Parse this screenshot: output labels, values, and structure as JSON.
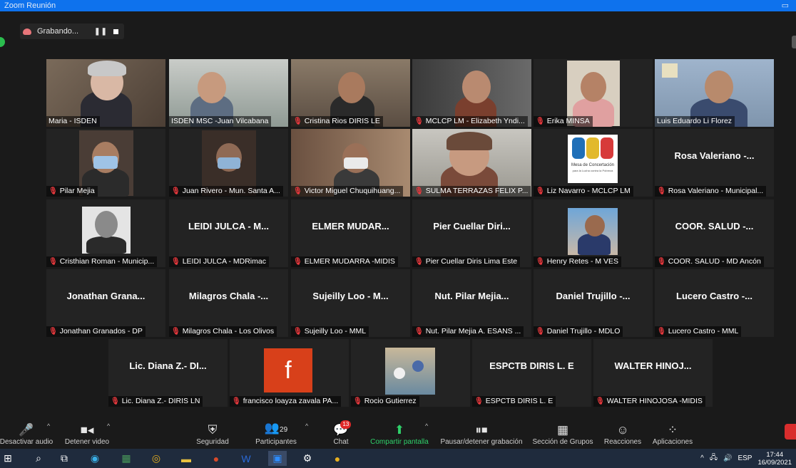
{
  "window": {
    "title": "Zoom Reunión"
  },
  "recording": {
    "label": "Grabando...",
    "pause_symbol": "❚❚"
  },
  "tiles": [
    {
      "name": "Maria - ISDEN",
      "muted": false,
      "video": true,
      "active": true
    },
    {
      "name": "ISDEN MSC -Juan Vilcabana",
      "muted": false,
      "video": true
    },
    {
      "name": "Cristina Rios DIRIS LE",
      "muted": true,
      "video": true
    },
    {
      "name": "MCLCP LM - Elizabeth Yndi...",
      "muted": true,
      "video": true
    },
    {
      "name": "Erika MINSA",
      "muted": true,
      "video": true
    },
    {
      "name": "Luis Eduardo Li Florez",
      "muted": false,
      "video": true
    },
    {
      "name": "Pilar Mejia",
      "muted": true,
      "video": true
    },
    {
      "name": "Juan Rivero - Mun. Santa A...",
      "muted": true,
      "video": true
    },
    {
      "name": "Victor Miguel Chuquihuang...",
      "muted": true,
      "video": true
    },
    {
      "name": "SULMA TERRAZAS FELIX P...",
      "muted": true,
      "video": true
    },
    {
      "name": "Liz Navarro - MCLCP LM",
      "muted": true,
      "video": true,
      "logo_caption": "Mesa de Concertación",
      "logo_subcaption": "para la Lucha contra la Pobreza"
    },
    {
      "name": "Rosa Valeriano - Municipal...",
      "muted": true,
      "video": false,
      "display": "Rosa Valeriano -..."
    },
    {
      "name": "Cristhian Roman - Municip...",
      "muted": true,
      "video": true
    },
    {
      "name": "LEIDI JULCA - MDRimac",
      "muted": true,
      "video": false,
      "display": "LEIDI JULCA - M..."
    },
    {
      "name": "ELMER MUDARRA -MIDIS",
      "muted": true,
      "video": false,
      "display": "ELMER MUDAR..."
    },
    {
      "name": "Pier Cuellar Diris Lima Este",
      "muted": true,
      "video": false,
      "display": "Pier Cuellar Diri..."
    },
    {
      "name": "Henry Retes - M VES",
      "muted": true,
      "video": true
    },
    {
      "name": "COOR. SALUD - MD Ancón",
      "muted": true,
      "video": false,
      "display": "COOR. SALUD -..."
    },
    {
      "name": "Jonathan Granados - DP",
      "muted": true,
      "video": false,
      "display": "Jonathan Grana..."
    },
    {
      "name": "Milagros Chala - Los Olivos",
      "muted": true,
      "video": false,
      "display": "Milagros Chala -..."
    },
    {
      "name": "Sujeilly Loo - MML",
      "muted": true,
      "video": false,
      "display": "Sujeilly Loo - M..."
    },
    {
      "name": "Nut. Pilar Mejia A. ESANS ...",
      "muted": true,
      "video": false,
      "display": "Nut. Pilar Mejia..."
    },
    {
      "name": "Daniel Trujillo - MDLO",
      "muted": true,
      "video": false,
      "display": "Daniel Trujillo -..."
    },
    {
      "name": "Lucero Castro - MML",
      "muted": true,
      "video": false,
      "display": "Lucero Castro -..."
    },
    {
      "name": "Lic. Diana Z.- DIRIS LN",
      "muted": true,
      "video": false,
      "display": "Lic. Diana Z.- DI..."
    },
    {
      "name": "francisco loayza zavala PA...",
      "muted": true,
      "video": true,
      "avatar_letter": "f"
    },
    {
      "name": "Rocio Gutierrez",
      "muted": true,
      "video": true
    },
    {
      "name": "ESPCTB DIRIS L. E",
      "muted": true,
      "video": false,
      "display": "ESPCTB DIRIS L. E"
    },
    {
      "name": "WALTER HINOJOSA -MIDIS",
      "muted": true,
      "video": false,
      "display": "WALTER HINOJ..."
    }
  ],
  "toolbar": {
    "mute_label": "Desactivar audio",
    "video_label": "Detener video",
    "security_label": "Seguridad",
    "participants_label": "Participantes",
    "participants_count": "29",
    "chat_label": "Chat",
    "chat_badge": "13",
    "share_label": "Compartir pantalla",
    "record_label": "Pausar/detener grabación",
    "breakout_label": "Sección de Grupos",
    "reactions_label": "Reacciones",
    "apps_label": "Aplicaciones"
  },
  "taskbar": {
    "language": "ESP",
    "time": "17:44",
    "date": "16/09/2021"
  },
  "colors": {
    "active_speaker": "#c8e05a",
    "muted_icon": "#e8383d",
    "share_green": "#2fd06a",
    "titlebar": "#0e72ed"
  }
}
